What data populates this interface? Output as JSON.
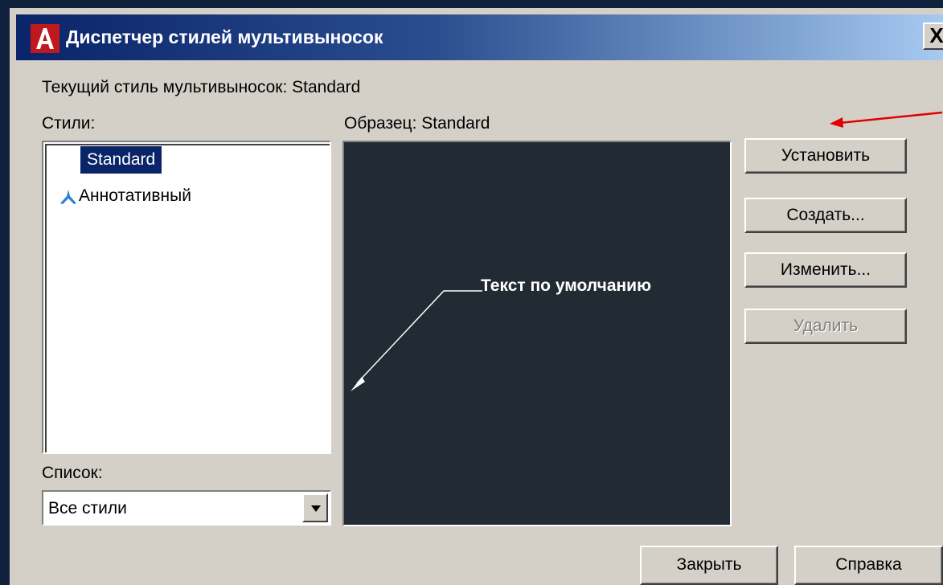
{
  "window": {
    "title": "Диспетчер стилей мультивыносок",
    "close_glyph": "X",
    "app_icon": "autocad-logo-icon",
    "accent_color": "#0a246a"
  },
  "current_style": {
    "text": "Текущий стиль мультивыносок: Standard"
  },
  "styles": {
    "label": "Стили:",
    "items": [
      {
        "label": "Standard",
        "selected": true,
        "icon": ""
      },
      {
        "label": "Аннотативный",
        "selected": false,
        "icon": "annotative-icon"
      }
    ]
  },
  "preview": {
    "label": "Образец: Standard",
    "leader_text": "Текст по умолчанию",
    "background_color": "#222a33"
  },
  "buttons": {
    "set": "Установить",
    "create": "Создать...",
    "modify": "Изменить...",
    "delete": "Удалить",
    "close": "Закрыть",
    "help": "Справка"
  },
  "list_filter": {
    "label": "Список:",
    "selected": "Все стили"
  }
}
